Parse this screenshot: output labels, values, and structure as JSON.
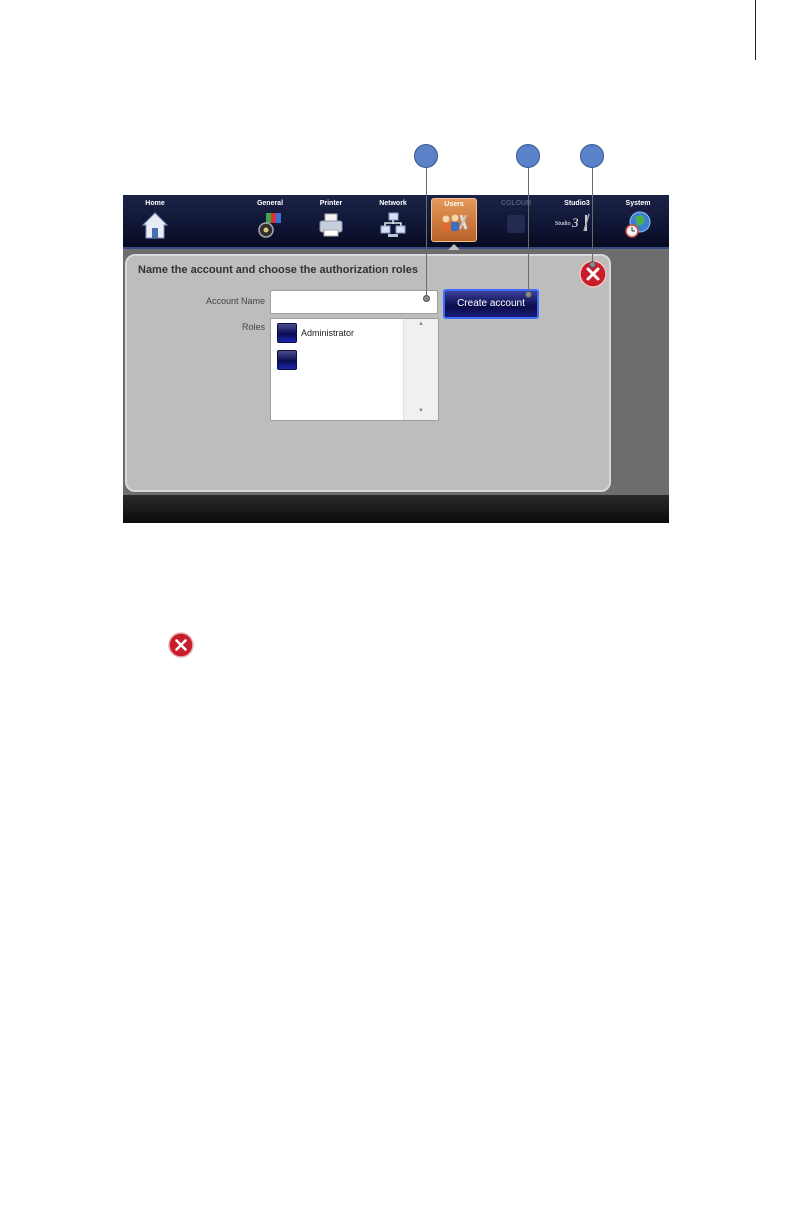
{
  "nav": {
    "items": [
      {
        "id": "home",
        "label": "Home"
      },
      {
        "id": "general",
        "label": "General"
      },
      {
        "id": "printer",
        "label": "Printer"
      },
      {
        "id": "network",
        "label": "Network"
      },
      {
        "id": "users",
        "label": "Users"
      },
      {
        "id": "colour",
        "label": "COLOUR"
      },
      {
        "id": "studio3",
        "label": "Studio3"
      },
      {
        "id": "system",
        "label": "System"
      }
    ],
    "active": "Users"
  },
  "dialog": {
    "title": "Name the account and choose the authorization roles",
    "account_name_label": "Account Name",
    "account_name_value": "",
    "roles_label": "Roles",
    "create_button": "Create account",
    "roles": [
      {
        "label": "Administrator"
      },
      {
        "label": ""
      }
    ]
  },
  "studio_logo_text": "Studio",
  "studio_logo_num": "3",
  "colors": {
    "nav_background": "#0d1330",
    "active_tab": "#d2803f",
    "dialog_background": "#bdbdbd",
    "create_button": "#0b0c4a",
    "close_icon": "#c81d2b",
    "callout": "#5b82c8"
  }
}
